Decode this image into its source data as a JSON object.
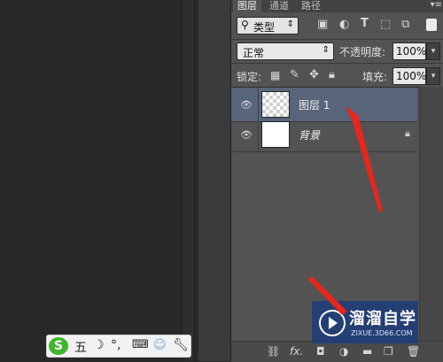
{
  "colors": {
    "accent_arrow": "#e8261c",
    "selected_layer": "#58647a",
    "panel_bg": "#535353"
  },
  "tabs": [
    {
      "label": "图层",
      "active": true
    },
    {
      "label": "通道",
      "active": false
    },
    {
      "label": "路径",
      "active": false
    }
  ],
  "panel_menu_icon": "panel-menu-icon",
  "filter": {
    "search_icon": "search-icon",
    "type_label": "类型",
    "icons": [
      "image-filter-icon",
      "adjustment-filter-icon",
      "text-filter-icon",
      "shape-filter-icon",
      "smart-object-filter-icon",
      "filter-toggle-icon"
    ]
  },
  "blend": {
    "mode_label": "正常",
    "opacity_label": "不透明度:",
    "opacity_value": "100%"
  },
  "lock": {
    "label": "锁定:",
    "fill_label": "填充:",
    "fill_value": "100%"
  },
  "layers": [
    {
      "name": "图层 1",
      "selected": true,
      "thumb": "transparent"
    },
    {
      "name": "背景",
      "selected": false,
      "thumb": "white",
      "locked": true
    }
  ],
  "bottom_bar": {
    "fx_label": "fx."
  },
  "ime": {
    "mode": "五",
    "logo": "S"
  },
  "watermark": {
    "title": "溜溜自学",
    "url": "ZIXUE.3D66.COM"
  }
}
